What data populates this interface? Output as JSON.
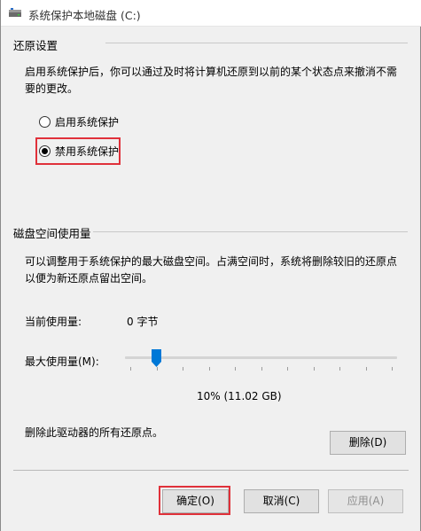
{
  "window": {
    "title": "系统保护本地磁盘 (C:)"
  },
  "restore_settings": {
    "group_label": "还原设置",
    "description": "启用系统保护后，你可以通过及时将计算机还原到以前的某个状态点来撤消不需要的更改。",
    "options": [
      {
        "label": "启用系统保护",
        "selected": false
      },
      {
        "label": "禁用系统保护",
        "selected": true
      }
    ]
  },
  "disk_usage": {
    "group_label": "磁盘空间使用量",
    "description": "可以调整用于系统保护的最大磁盘空间。占满空间时，系统将删除较旧的还原点以便为新还原点留出空间。",
    "current_usage_label": "当前使用量:",
    "current_usage_value": "0 字节",
    "max_usage_label": "最大使用量(M):",
    "max_usage_fraction": 0.1,
    "max_usage_readout": "10% (11.02 GB)",
    "delete_text": "删除此驱动器的所有还原点。",
    "delete_button": "删除(D)"
  },
  "footer": {
    "ok_button": "确定(O)",
    "cancel_button": "取消(C)",
    "apply_button": "应用(A)"
  },
  "colors": {
    "highlight_box": "#e0313a",
    "slider_thumb": "#0078d7"
  }
}
